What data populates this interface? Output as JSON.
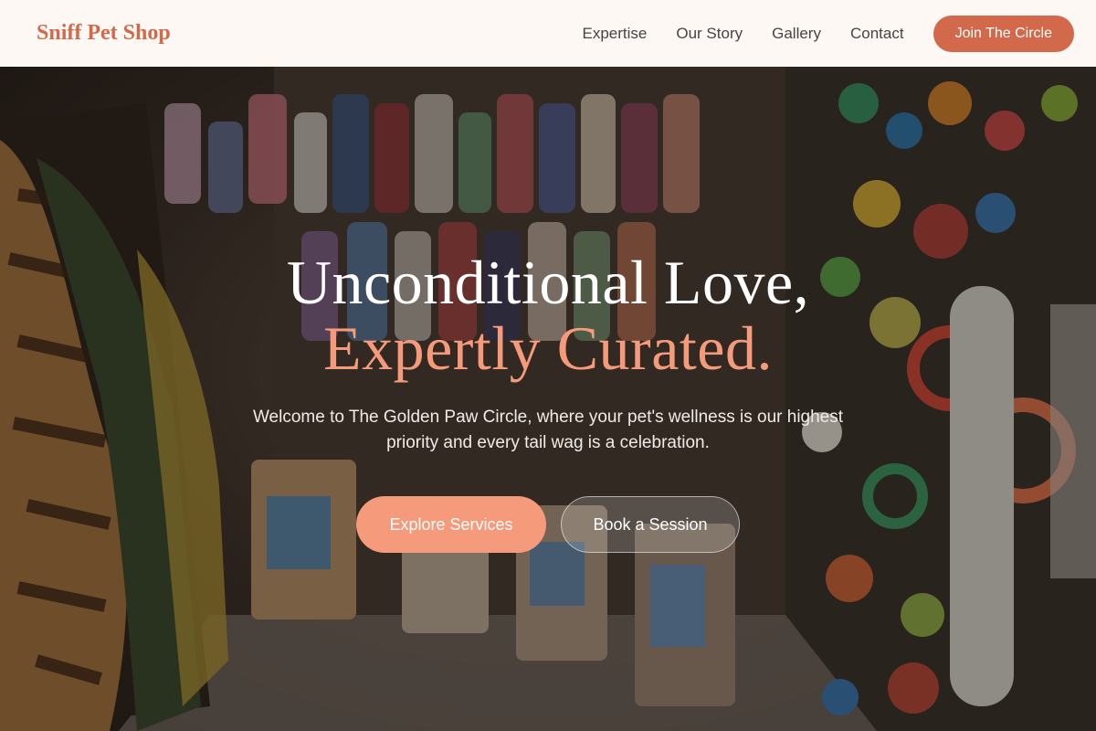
{
  "nav": {
    "brand": "Sniff Pet Shop",
    "links": [
      "Expertise",
      "Our Story",
      "Gallery",
      "Contact"
    ],
    "cta": "Join The Circle"
  },
  "hero": {
    "headline_line1": "Unconditional Love,",
    "headline_line2": "Expertly Curated.",
    "subtext": "Welcome to The Golden Paw Circle, where your pet's wellness is our highest priority and every tail wag is a celebration.",
    "primary_cta": "Explore Services",
    "secondary_cta": "Book a Session",
    "background_image": "pet-shop-interior-photo"
  },
  "colors": {
    "accent": "#d2694a",
    "accent_light": "#f59a7a",
    "nav_background": "#fdf8f4",
    "nav_text": "#4a4340"
  }
}
